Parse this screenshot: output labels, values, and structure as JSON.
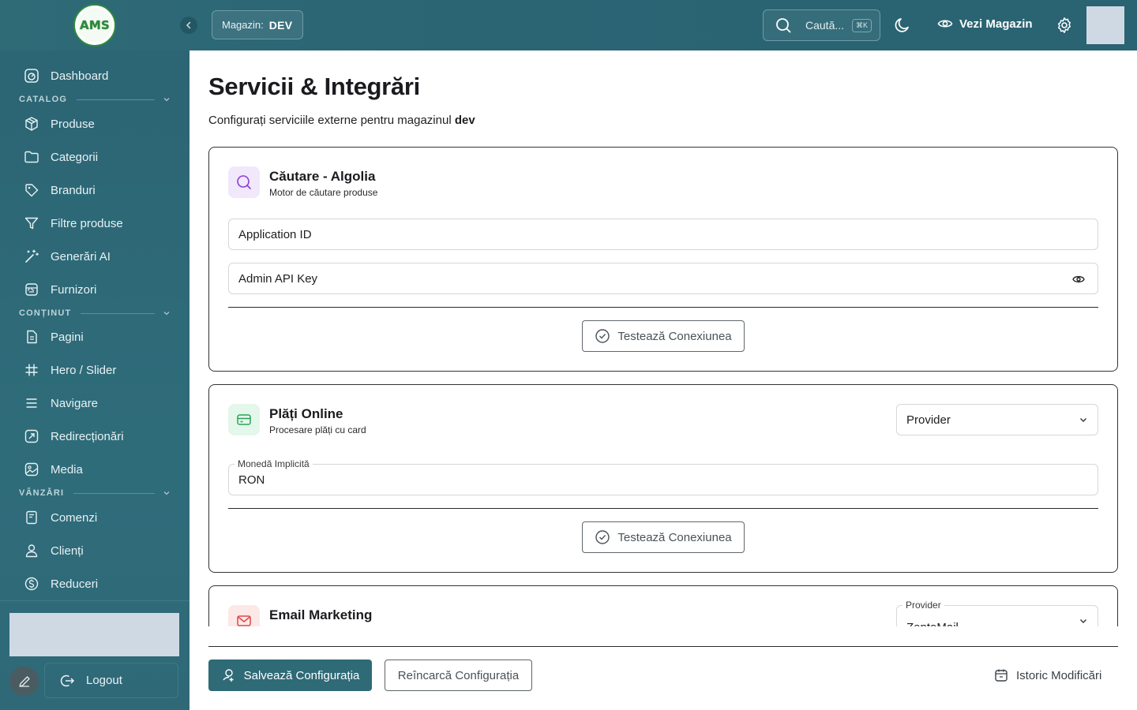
{
  "header": {
    "logo_text": "AMS",
    "store_label": "Magazin:",
    "store_value": "DEV",
    "search_placeholder": "Caută...",
    "search_shortcut": "⌘K",
    "view_store": "Vezi Magazin"
  },
  "sidebar": {
    "dashboard": "Dashboard",
    "sections": {
      "catalog": "CATALOG",
      "content": "CONȚINUT",
      "sales": "VÂNZĂRI"
    },
    "catalog_items": [
      "Produse",
      "Categorii",
      "Branduri",
      "Filtre produse",
      "Generări AI",
      "Furnizori"
    ],
    "content_items": [
      "Pagini",
      "Hero / Slider",
      "Navigare",
      "Redirecționări",
      "Media"
    ],
    "sales_items": [
      "Comenzi",
      "Clienți",
      "Reduceri"
    ],
    "logout": "Logout"
  },
  "page": {
    "title": "Servicii & Integrări",
    "subtitle_prefix": "Configurați serviciile externe pentru magazinul ",
    "subtitle_store": "dev"
  },
  "cards": {
    "algolia": {
      "title": "Căutare - Algolia",
      "subtitle": "Motor de căutare produse",
      "app_id_placeholder": "Application ID",
      "api_key_placeholder": "Admin API Key",
      "test_label": "Testează Conexiunea"
    },
    "payments": {
      "title": "Plăți Online",
      "subtitle": "Procesare plăți cu card",
      "provider_placeholder": "Provider",
      "currency_label": "Monedă Implicită",
      "currency_value": "RON",
      "test_label": "Testează Conexiunea"
    },
    "email": {
      "title": "Email Marketing",
      "provider_label": "Provider",
      "provider_value": "ZeptoMail"
    }
  },
  "footer": {
    "save": "Salvează Configurația",
    "reload": "Reîncarcă Configurația",
    "history": "Istoric Modificări"
  },
  "colors": {
    "primary": "#2f6a77",
    "algolia_icon_bg": "#f1e8fb",
    "payments_icon_bg": "#e3f7ea",
    "email_icon_bg": "#fde8e8"
  }
}
